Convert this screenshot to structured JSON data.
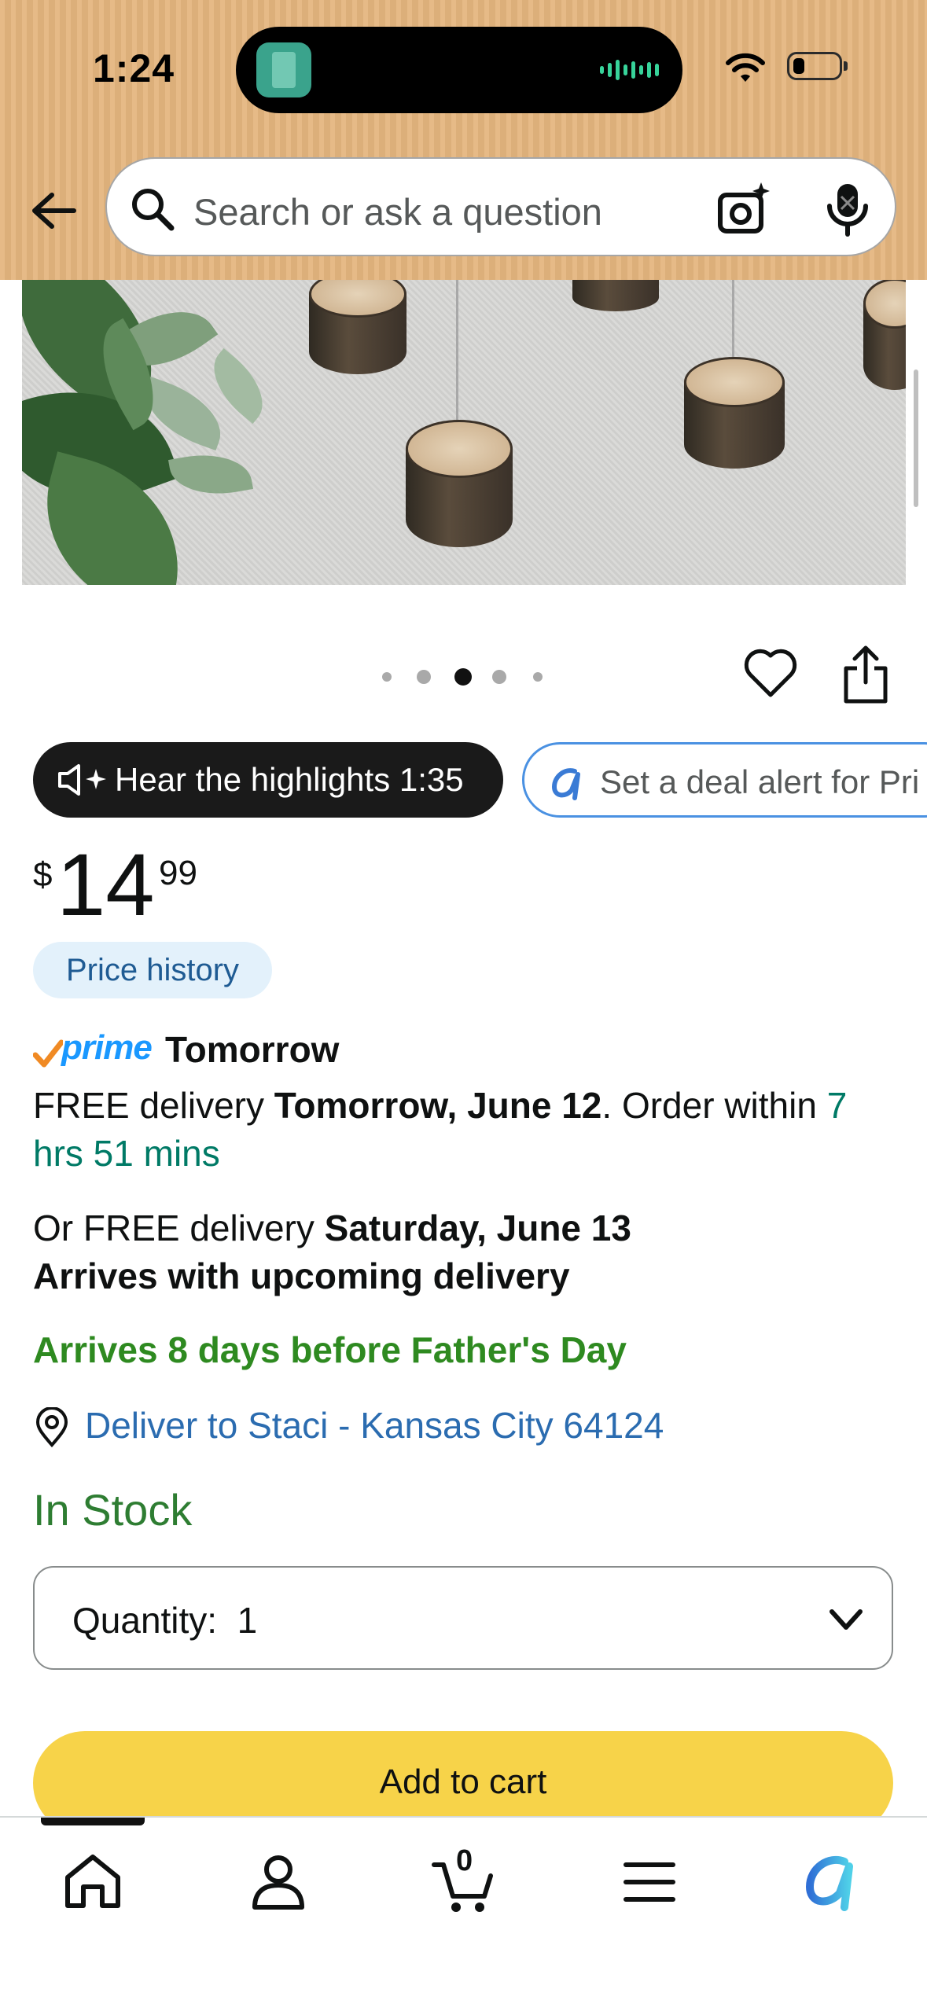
{
  "status_bar": {
    "time": "1:24"
  },
  "search": {
    "placeholder": "Search or ask a question"
  },
  "gallery": {
    "dot_count": 5,
    "active_index": 2
  },
  "chips": {
    "highlights_label": "Hear the highlights 1:35",
    "deal_alert_label": "Set a deal alert for Pri"
  },
  "price": {
    "currency": "$",
    "whole": "14",
    "fraction": "99"
  },
  "price_history_label": "Price history",
  "prime": {
    "brand": "prime",
    "speed": "Tomorrow"
  },
  "delivery": {
    "line1_prefix": "FREE delivery ",
    "line1_date": "Tomorrow, June 12",
    "line1_mid": ". Order within ",
    "line1_countdown": "7 hrs 51 mins",
    "line2_prefix": "Or FREE delivery ",
    "line2_date": "Saturday, June 13",
    "line2_note": "Arrives with upcoming delivery",
    "holiday_note": "Arrives 8 days before Father's Day"
  },
  "deliver_to": "Deliver to Staci - Kansas City 64124",
  "stock_status": "In Stock",
  "quantity": {
    "label": "Quantity:",
    "value": "1"
  },
  "add_to_cart_label": "Add to cart",
  "cart_count": "0",
  "colors": {
    "header": "#e4b57e",
    "add_to_cart": "#f7d349",
    "in_stock": "#2e7d32",
    "link": "#2b6cb0",
    "prime": "#1a98ff"
  }
}
